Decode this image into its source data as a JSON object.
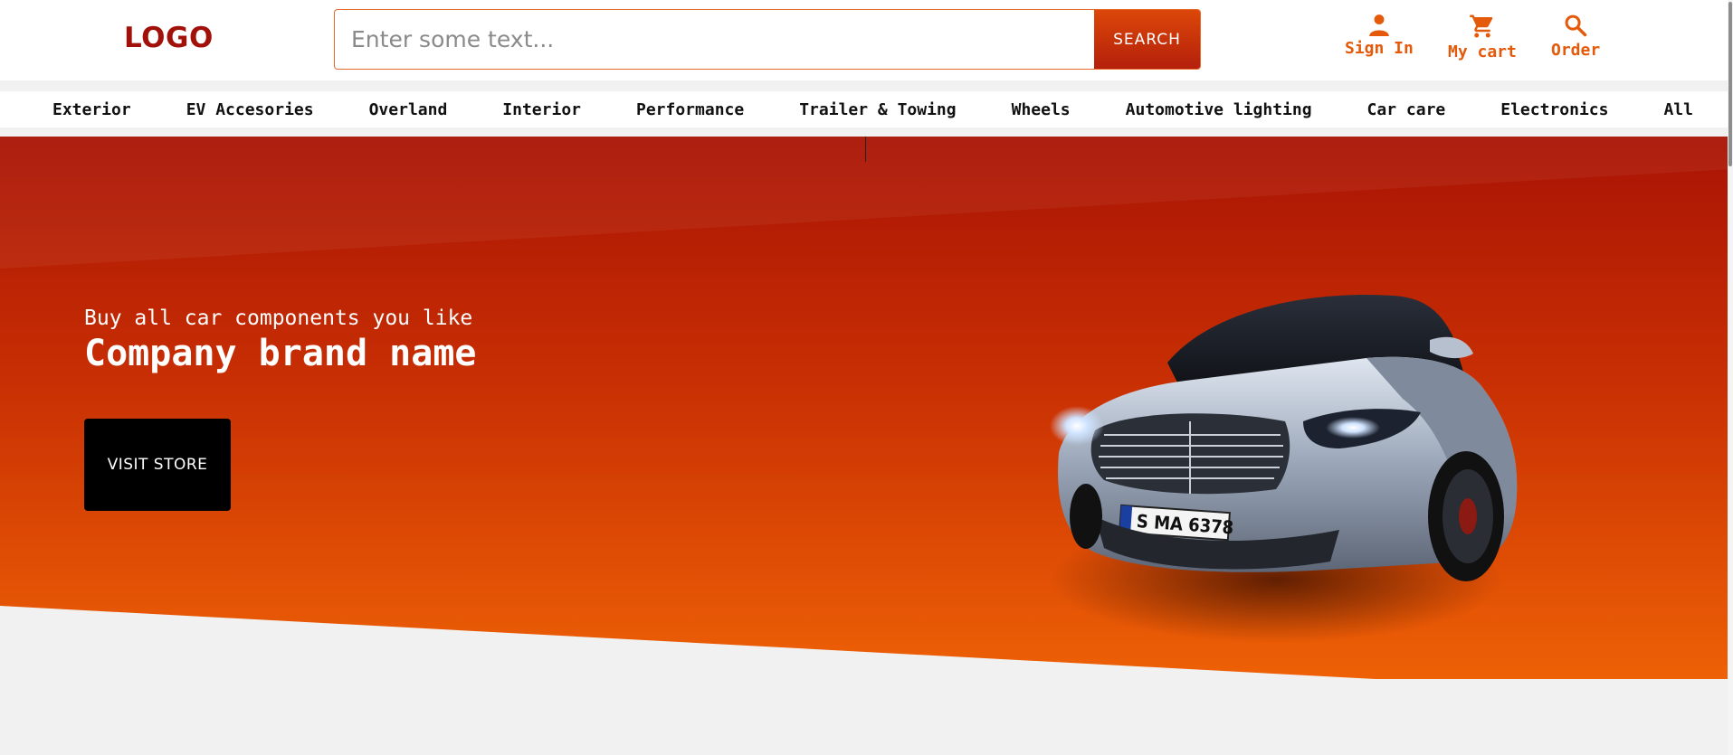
{
  "header": {
    "logo": "LOGO",
    "search": {
      "placeholder": "Enter some text...",
      "value": "",
      "button_label": "SEARCH"
    },
    "actions": [
      {
        "label": "Sign In",
        "icon": "person-icon"
      },
      {
        "label": "My cart",
        "icon": "cart-icon"
      },
      {
        "label": "Order",
        "icon": "search-icon"
      }
    ]
  },
  "nav": {
    "items": [
      {
        "label": "Exterior"
      },
      {
        "label": "EV Accesories"
      },
      {
        "label": "Overland"
      },
      {
        "label": "Interior"
      },
      {
        "label": "Performance"
      },
      {
        "label": "Trailer & Towing"
      },
      {
        "label": "Wheels"
      },
      {
        "label": "Automotive lighting"
      },
      {
        "label": "Car care"
      },
      {
        "label": "Electronics"
      },
      {
        "label": "All"
      }
    ]
  },
  "hero": {
    "subtitle": "Buy all car components you like",
    "title": "Company brand name",
    "cta_label": "VISIT STORE",
    "license_plate": "S MA 6378"
  },
  "colors": {
    "brand": "#a11109",
    "accent": "#e45a0a",
    "hero_top": "#a91304",
    "hero_bottom": "#ec5e05"
  }
}
